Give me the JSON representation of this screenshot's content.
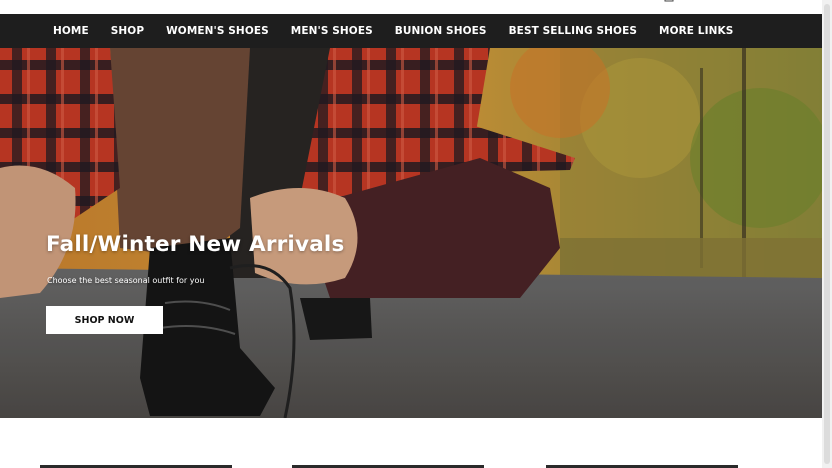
{
  "nav": {
    "items": [
      {
        "label": "HOME"
      },
      {
        "label": "SHOP"
      },
      {
        "label": "WOMEN'S SHOES"
      },
      {
        "label": "MEN'S SHOES"
      },
      {
        "label": "BUNION SHOES"
      },
      {
        "label": "BEST SELLING SHOES"
      },
      {
        "label": "MORE LINKS"
      }
    ]
  },
  "hero": {
    "title": "Fall/Winter New Arrivals",
    "subtitle": "Choose the best seasonal outfit for you",
    "button_label": "SHOP NOW"
  },
  "icons": {
    "cart": "cart-icon"
  },
  "colors": {
    "nav_background": "#1e1e1e",
    "nav_text": "#ffffff",
    "button_background": "#ffffff",
    "button_text": "#111111"
  }
}
